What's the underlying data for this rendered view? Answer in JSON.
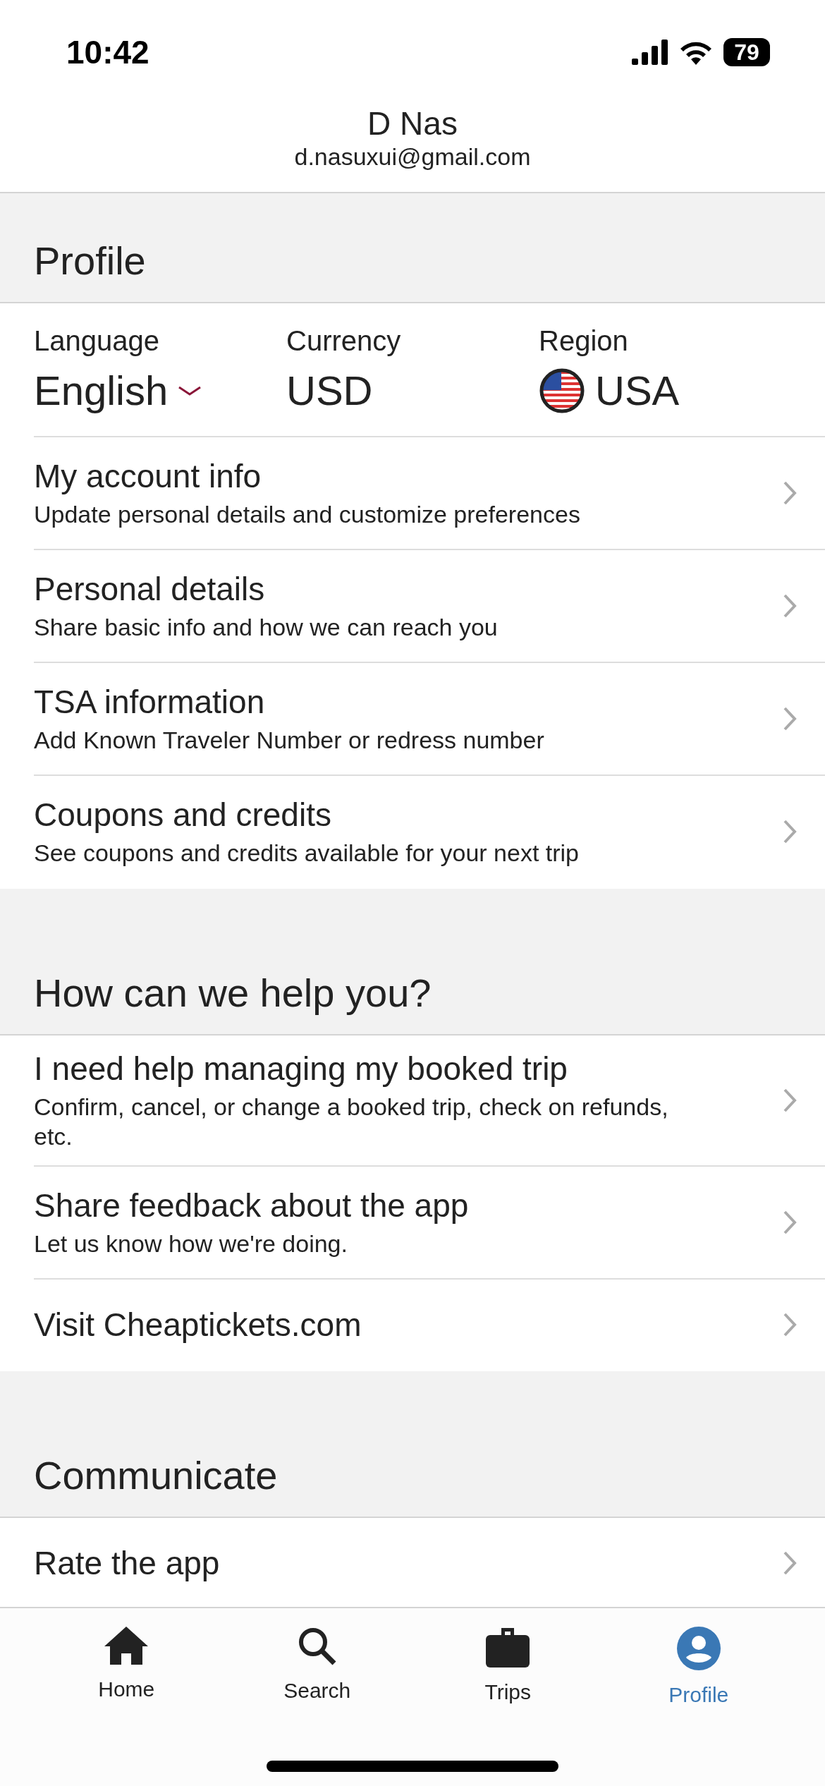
{
  "status_bar": {
    "time": "10:42",
    "battery": "79"
  },
  "header": {
    "name": "D Nas",
    "email": "d.nasuxui@gmail.com"
  },
  "sections": [
    {
      "title": "Profile",
      "locale": [
        {
          "kind": "language",
          "label": "Language",
          "value": "English"
        },
        {
          "kind": "currency",
          "label": "Currency",
          "value": "USD"
        },
        {
          "kind": "region",
          "label": "Region",
          "value": "USA"
        }
      ],
      "items": [
        {
          "title": "My account info",
          "subtitle": "Update personal details and customize preferences"
        },
        {
          "title": "Personal details",
          "subtitle": "Share basic info and how we can reach you"
        },
        {
          "title": "TSA information",
          "subtitle": "Add Known Traveler Number or redress number"
        },
        {
          "title": "Coupons and credits",
          "subtitle": "See coupons and credits available for your next trip"
        }
      ]
    },
    {
      "title": "How can we help you?",
      "items": [
        {
          "title": "I need help managing my booked trip",
          "subtitle": "Confirm, cancel, or change a booked trip, check on refunds, etc."
        },
        {
          "title": "Share feedback about the app",
          "subtitle": "Let us know how we're doing."
        },
        {
          "title": "Visit Cheaptickets.com"
        }
      ]
    },
    {
      "title": "Communicate",
      "items": [
        {
          "title": "Rate the app"
        }
      ]
    }
  ],
  "tabs": [
    {
      "kind": "home",
      "label": "Home",
      "selected": false
    },
    {
      "kind": "search",
      "label": "Search",
      "selected": false
    },
    {
      "kind": "trips",
      "label": "Trips",
      "selected": false
    },
    {
      "kind": "profile",
      "label": "Profile",
      "selected": true
    }
  ]
}
